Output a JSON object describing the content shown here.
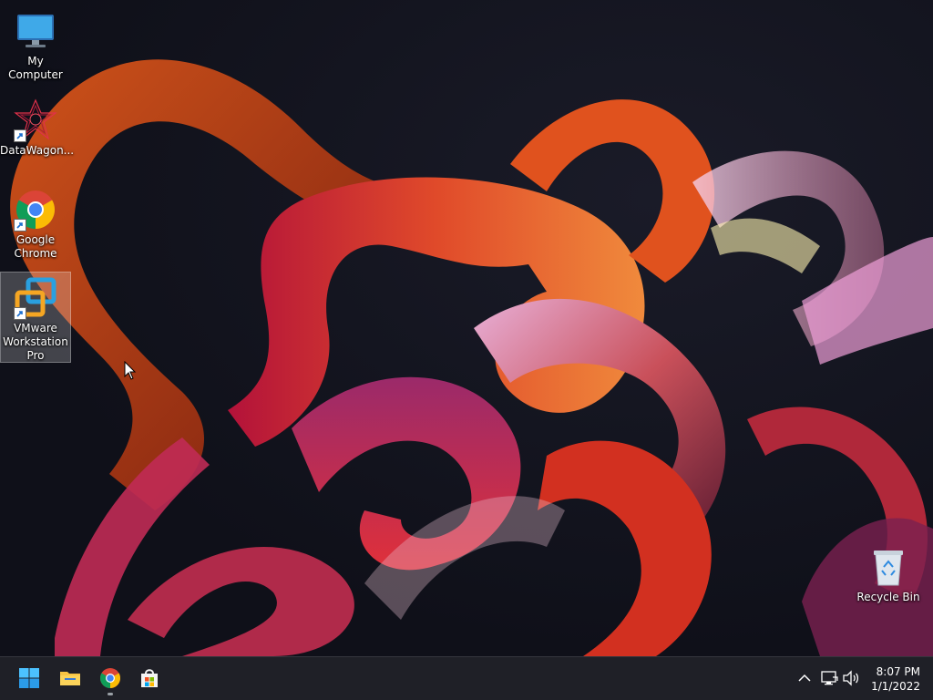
{
  "desktop": {
    "icons": [
      {
        "id": "my-computer",
        "label": "My Computer",
        "shortcut": false,
        "selected": false
      },
      {
        "id": "datawagon",
        "label": "DataWagon...",
        "shortcut": true,
        "selected": false
      },
      {
        "id": "google-chrome",
        "label": "Google Chrome",
        "shortcut": true,
        "selected": false
      },
      {
        "id": "vmware",
        "label": "VMware Workstation Pro",
        "shortcut": true,
        "selected": true
      },
      {
        "id": "recycle-bin",
        "label": "Recycle Bin",
        "shortcut": false,
        "selected": false
      }
    ]
  },
  "taskbar": {
    "pinned": [
      {
        "name": "start-button",
        "icon": "windows-logo-icon",
        "running": false
      },
      {
        "name": "file-explorer-button",
        "icon": "folder-icon",
        "running": false
      },
      {
        "name": "chrome-button",
        "icon": "chrome-icon",
        "running": true
      },
      {
        "name": "microsoft-store-button",
        "icon": "store-icon",
        "running": false
      }
    ],
    "tray": {
      "icons": [
        "chevron-up-icon",
        "network-icon",
        "volume-icon"
      ],
      "time": "8:07 PM",
      "date": "1/1/2022"
    },
    "colors": {
      "background": "#1f2027",
      "accent": "#4cc2ff"
    }
  }
}
